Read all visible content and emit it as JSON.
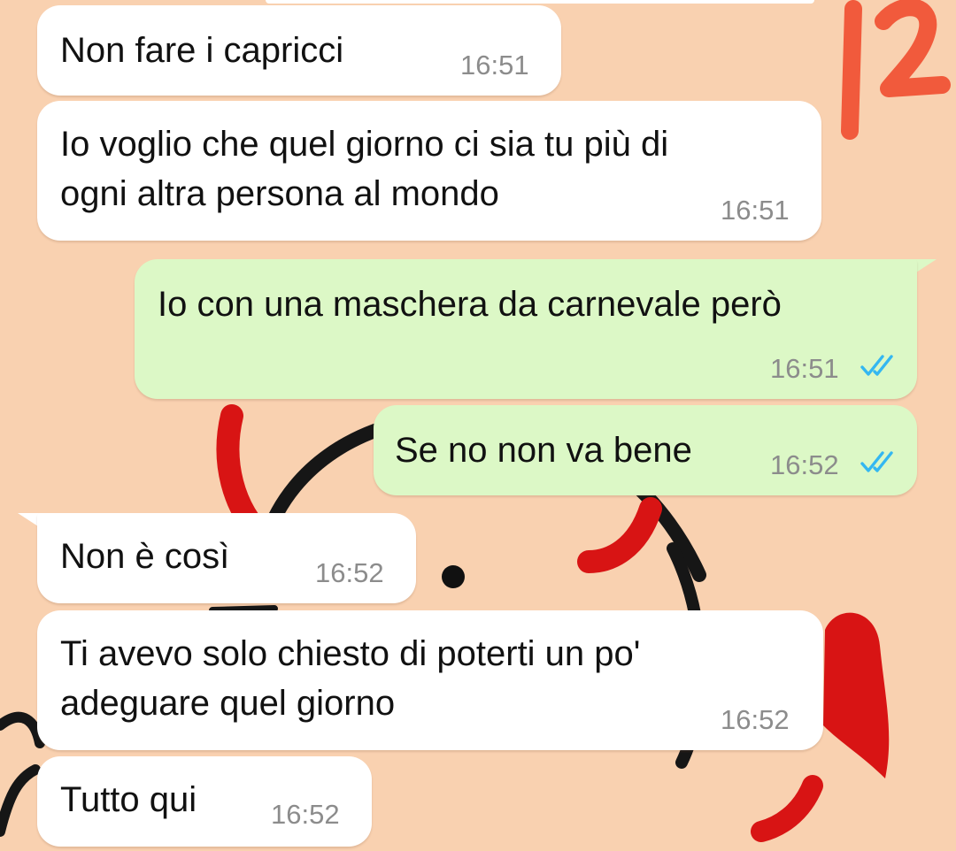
{
  "annotation": {
    "page_number": "12"
  },
  "colors": {
    "wallpaper": "#f9d1b0",
    "incoming_bubble": "#ffffff",
    "outgoing_bubble": "#dcf8c6",
    "read_ticks": "#34b7f1",
    "annotation": "#f15a3c"
  },
  "messages": [
    {
      "direction": "incoming",
      "text_lines": [
        "Non fare i capricci"
      ],
      "time": "16:51"
    },
    {
      "direction": "incoming",
      "text_lines": [
        "Io voglio che quel giorno ci sia tu più di",
        "ogni altra persona al mondo"
      ],
      "time": "16:51"
    },
    {
      "direction": "outgoing",
      "text_lines": [
        "Io con una maschera da carnevale però"
      ],
      "time": "16:51",
      "status": "read-double-check-icon"
    },
    {
      "direction": "outgoing",
      "text_lines": [
        "Se no non va bene"
      ],
      "time": "16:52",
      "status": "read-double-check-icon"
    },
    {
      "direction": "incoming",
      "text_lines": [
        "Non è così"
      ],
      "time": "16:52"
    },
    {
      "direction": "incoming",
      "text_lines": [
        "Ti avevo solo chiesto di poterti un po'",
        "adeguare quel giorno"
      ],
      "time": "16:52"
    },
    {
      "direction": "incoming",
      "text_lines": [
        "Tutto qui"
      ],
      "time": "16:52"
    }
  ]
}
